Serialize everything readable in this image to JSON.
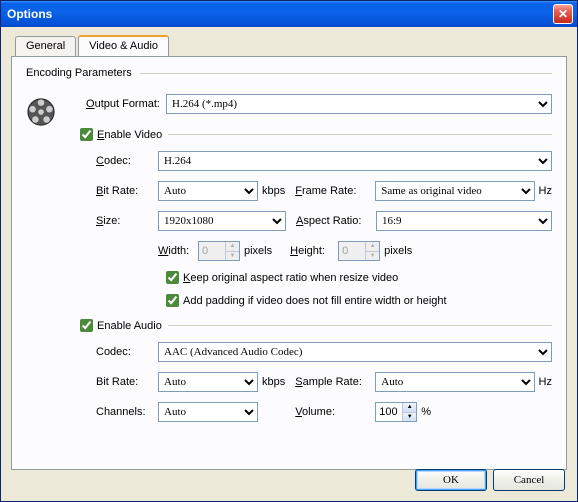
{
  "window": {
    "title": "Options"
  },
  "tabs": {
    "general": "General",
    "va": "Video & Audio"
  },
  "enc_legend": "Encoding Parameters",
  "output": {
    "label": "Output Format:",
    "value": "H.264 (*.mp4)"
  },
  "enable_video": "Enable Video",
  "video": {
    "codec_lbl": "Codec:",
    "codec_val": "H.264",
    "bitrate_lbl": "Bit Rate:",
    "bitrate_val": "Auto",
    "bitrate_unit": "kbps",
    "framerate_lbl": "Frame Rate:",
    "framerate_val": "Same as original video",
    "framerate_unit": "Hz",
    "size_lbl": "Size:",
    "size_val": "1920x1080",
    "aspect_lbl": "Aspect Ratio:",
    "aspect_val": "16:9",
    "width_lbl": "Width:",
    "width_val": "0",
    "px": "pixels",
    "height_lbl": "Height:",
    "height_val": "0",
    "keep_ratio": "Keep original aspect ratio when resize video",
    "padding": "Add padding if video does not fill entire width or height"
  },
  "enable_audio": "Enable Audio",
  "audio": {
    "codec_lbl": "Codec:",
    "codec_val": "AAC (Advanced Audio Codec)",
    "bitrate_lbl": "Bit Rate:",
    "bitrate_val": "Auto",
    "bitrate_unit": "kbps",
    "samplerate_lbl": "Sample Rate:",
    "samplerate_val": "Auto",
    "samplerate_unit": "Hz",
    "channels_lbl": "Channels:",
    "channels_val": "Auto",
    "volume_lbl": "Volume:",
    "volume_val": "100",
    "volume_unit": "%"
  },
  "buttons": {
    "ok": "OK",
    "cancel": "Cancel"
  }
}
